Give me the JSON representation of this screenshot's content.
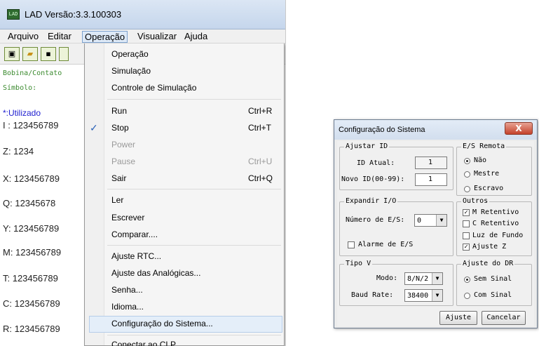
{
  "app": {
    "title": "LAD Versão:3.3.100303",
    "icon": "lad-app-icon",
    "menubar": [
      "Arquivo",
      "Editar",
      "Operação",
      "Visualizar",
      "Ajuda"
    ],
    "left_panel": {
      "bobina_label": "Bobina/Contato",
      "simbolo_label": "Símbolo:",
      "utilizado": "*:Utilizado",
      "rows": [
        "I : 123456789",
        "Z: 1234",
        "X: 123456789",
        "Q: 12345678",
        "Y: 123456789",
        "M: 123456789",
        "T: 123456789",
        "C: 123456789",
        "R: 123456789"
      ]
    }
  },
  "dropdown": {
    "items": [
      {
        "label": "Operação",
        "shortcut": "",
        "state": "normal"
      },
      {
        "label": "Simulação",
        "shortcut": "",
        "state": "normal"
      },
      {
        "label": "Controle de Simulação",
        "shortcut": "",
        "state": "normal"
      },
      {
        "label": "Run",
        "shortcut": "Ctrl+R",
        "state": "normal"
      },
      {
        "label": "Stop",
        "shortcut": "Ctrl+T",
        "state": "checked"
      },
      {
        "label": "Power",
        "shortcut": "",
        "state": "disabled"
      },
      {
        "label": "Pause",
        "shortcut": "Ctrl+U",
        "state": "disabled"
      },
      {
        "label": "Sair",
        "shortcut": "Ctrl+Q",
        "state": "normal"
      },
      {
        "label": "Ler",
        "shortcut": "",
        "state": "normal"
      },
      {
        "label": "Escrever",
        "shortcut": "",
        "state": "normal"
      },
      {
        "label": "Comparar....",
        "shortcut": "",
        "state": "normal"
      },
      {
        "label": "Ajuste RTC...",
        "shortcut": "",
        "state": "normal"
      },
      {
        "label": "Ajuste das Analógicas...",
        "shortcut": "",
        "state": "normal"
      },
      {
        "label": "Senha...",
        "shortcut": "",
        "state": "normal"
      },
      {
        "label": "Idioma...",
        "shortcut": "",
        "state": "normal"
      },
      {
        "label": "Configuração do Sistema...",
        "shortcut": "",
        "state": "highlighted"
      },
      {
        "label": "Conectar ao CLP...",
        "shortcut": "",
        "state": "normal"
      }
    ]
  },
  "dialog": {
    "title": "Configuração do Sistema",
    "close_glyph": "X",
    "ajustar_id": {
      "group_title": "Ajustar ID",
      "id_atual_label": "ID Atual:",
      "id_atual_value": "1",
      "novo_id_label": "Novo ID(00-99):",
      "novo_id_value": "1"
    },
    "es_remota": {
      "group_title": "E/S Remota",
      "options": [
        "Não",
        "Mestre",
        "Escravo"
      ],
      "selected": "Não"
    },
    "expandir_io": {
      "group_title": "Expandir I/O",
      "numero_label": "Número de E/S:",
      "numero_value": "0",
      "alarme_label": "Alarme de E/S",
      "alarme_checked": false
    },
    "outros": {
      "group_title": "Outros",
      "items": [
        {
          "label": "M  Retentivo",
          "checked": true
        },
        {
          "label": "C Retentivo",
          "checked": false
        },
        {
          "label": "Luz de Fundo",
          "checked": false
        },
        {
          "label": "Ajuste Z",
          "checked": true
        }
      ]
    },
    "tipo_v": {
      "group_title": "Tipo V",
      "modo_label": "Modo:",
      "modo_value": "8/N/2",
      "baud_label": "Baud Rate:",
      "baud_value": "38400"
    },
    "ajuste_dr": {
      "group_title": "Ajuste do DR",
      "options": [
        "Sem Sinal",
        "Com Sinal"
      ],
      "selected": "Sem Sinal"
    },
    "buttons": {
      "ajuste": "Ajuste",
      "cancelar": "Cancelar"
    }
  }
}
